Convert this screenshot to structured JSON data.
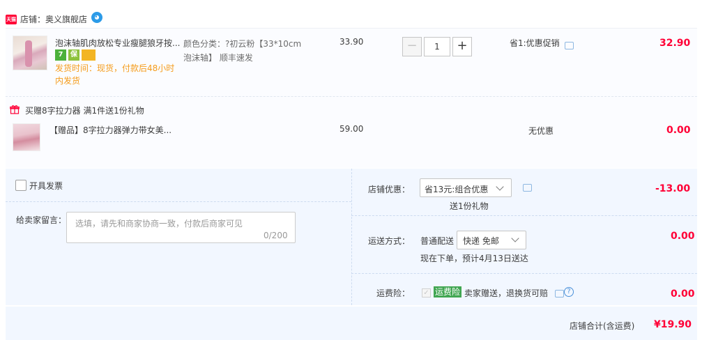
{
  "shop": {
    "badge": "天猫",
    "label": "店铺：奥义旗舰店"
  },
  "items": [
    {
      "title": "泡沫轴肌肉放松专业瘦腿狼牙按...",
      "service_icons": [
        "seven-day-return-icon",
        "guarantee-icon",
        "credit-card-icon"
      ],
      "service_glyphs": [
        "7",
        "保",
        ""
      ],
      "ship_time": "发货时间：现货，付款后48小时内发货",
      "sku_line1": "颜色分类：?初云粉【33*10cm",
      "sku_line2": "泡沫轴】 顺丰速发",
      "price": "33.90",
      "qty_minus": "−",
      "qty": "1",
      "qty_plus": "+",
      "discount": "省1:优惠促销",
      "total": "32.90"
    },
    {
      "gift_header": "买赠8字拉力器   满1件送1份礼物",
      "title": "【赠品】8字拉力器弹力带女美...",
      "price": "59.00",
      "discount": "无优惠",
      "total": "0.00"
    }
  ],
  "invoice": {
    "label": "开具发票"
  },
  "memo": {
    "label": "给卖家留言：",
    "placeholder": "选填，请先和商家协商一致，付款后商家可见",
    "count": "0/200"
  },
  "shop_discount": {
    "label": "店铺优惠：",
    "selected": "省13元:组合优惠",
    "note": "送1份礼物",
    "value": "-13.00"
  },
  "shipping": {
    "label": "运送方式：",
    "method": "普通配送",
    "selected": "快递 免邮",
    "eta": "现在下单，预计4月13日送达",
    "value": "0.00"
  },
  "insurance": {
    "label": "运费险：",
    "check": "✓",
    "badge": "运费险",
    "text": "卖家赠送，退换货可赔",
    "help": "?",
    "value": "0.00"
  },
  "summary": {
    "label": "店铺合计(含运费)",
    "value": "¥19.90"
  },
  "colors": {
    "price_red": "#ff0036",
    "ship_orange": "#f59c1b",
    "panel_blue": "#f2f7ff",
    "insurance_green": "#41a652"
  }
}
